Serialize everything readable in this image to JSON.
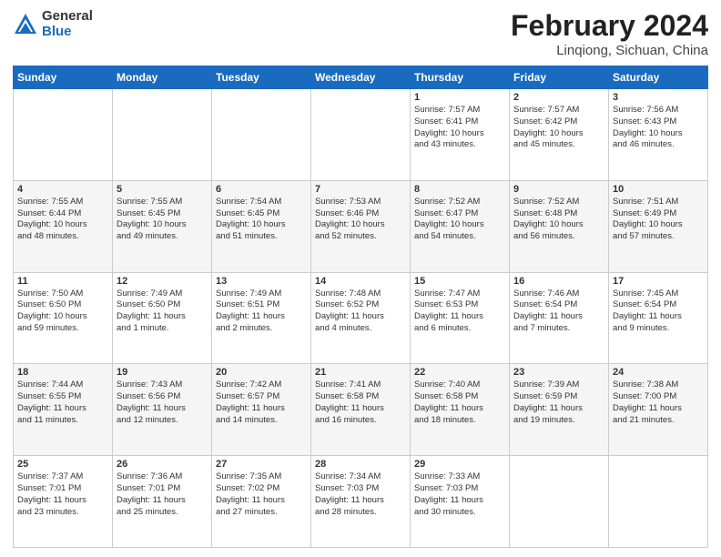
{
  "logo": {
    "general": "General",
    "blue": "Blue"
  },
  "title": {
    "month_year": "February 2024",
    "location": "Linqiong, Sichuan, China"
  },
  "weekdays": [
    "Sunday",
    "Monday",
    "Tuesday",
    "Wednesday",
    "Thursday",
    "Friday",
    "Saturday"
  ],
  "weeks": [
    [
      {
        "day": "",
        "info": ""
      },
      {
        "day": "",
        "info": ""
      },
      {
        "day": "",
        "info": ""
      },
      {
        "day": "",
        "info": ""
      },
      {
        "day": "1",
        "info": "Sunrise: 7:57 AM\nSunset: 6:41 PM\nDaylight: 10 hours\nand 43 minutes."
      },
      {
        "day": "2",
        "info": "Sunrise: 7:57 AM\nSunset: 6:42 PM\nDaylight: 10 hours\nand 45 minutes."
      },
      {
        "day": "3",
        "info": "Sunrise: 7:56 AM\nSunset: 6:43 PM\nDaylight: 10 hours\nand 46 minutes."
      }
    ],
    [
      {
        "day": "4",
        "info": "Sunrise: 7:55 AM\nSunset: 6:44 PM\nDaylight: 10 hours\nand 48 minutes."
      },
      {
        "day": "5",
        "info": "Sunrise: 7:55 AM\nSunset: 6:45 PM\nDaylight: 10 hours\nand 49 minutes."
      },
      {
        "day": "6",
        "info": "Sunrise: 7:54 AM\nSunset: 6:45 PM\nDaylight: 10 hours\nand 51 minutes."
      },
      {
        "day": "7",
        "info": "Sunrise: 7:53 AM\nSunset: 6:46 PM\nDaylight: 10 hours\nand 52 minutes."
      },
      {
        "day": "8",
        "info": "Sunrise: 7:52 AM\nSunset: 6:47 PM\nDaylight: 10 hours\nand 54 minutes."
      },
      {
        "day": "9",
        "info": "Sunrise: 7:52 AM\nSunset: 6:48 PM\nDaylight: 10 hours\nand 56 minutes."
      },
      {
        "day": "10",
        "info": "Sunrise: 7:51 AM\nSunset: 6:49 PM\nDaylight: 10 hours\nand 57 minutes."
      }
    ],
    [
      {
        "day": "11",
        "info": "Sunrise: 7:50 AM\nSunset: 6:50 PM\nDaylight: 10 hours\nand 59 minutes."
      },
      {
        "day": "12",
        "info": "Sunrise: 7:49 AM\nSunset: 6:50 PM\nDaylight: 11 hours\nand 1 minute."
      },
      {
        "day": "13",
        "info": "Sunrise: 7:49 AM\nSunset: 6:51 PM\nDaylight: 11 hours\nand 2 minutes."
      },
      {
        "day": "14",
        "info": "Sunrise: 7:48 AM\nSunset: 6:52 PM\nDaylight: 11 hours\nand 4 minutes."
      },
      {
        "day": "15",
        "info": "Sunrise: 7:47 AM\nSunset: 6:53 PM\nDaylight: 11 hours\nand 6 minutes."
      },
      {
        "day": "16",
        "info": "Sunrise: 7:46 AM\nSunset: 6:54 PM\nDaylight: 11 hours\nand 7 minutes."
      },
      {
        "day": "17",
        "info": "Sunrise: 7:45 AM\nSunset: 6:54 PM\nDaylight: 11 hours\nand 9 minutes."
      }
    ],
    [
      {
        "day": "18",
        "info": "Sunrise: 7:44 AM\nSunset: 6:55 PM\nDaylight: 11 hours\nand 11 minutes."
      },
      {
        "day": "19",
        "info": "Sunrise: 7:43 AM\nSunset: 6:56 PM\nDaylight: 11 hours\nand 12 minutes."
      },
      {
        "day": "20",
        "info": "Sunrise: 7:42 AM\nSunset: 6:57 PM\nDaylight: 11 hours\nand 14 minutes."
      },
      {
        "day": "21",
        "info": "Sunrise: 7:41 AM\nSunset: 6:58 PM\nDaylight: 11 hours\nand 16 minutes."
      },
      {
        "day": "22",
        "info": "Sunrise: 7:40 AM\nSunset: 6:58 PM\nDaylight: 11 hours\nand 18 minutes."
      },
      {
        "day": "23",
        "info": "Sunrise: 7:39 AM\nSunset: 6:59 PM\nDaylight: 11 hours\nand 19 minutes."
      },
      {
        "day": "24",
        "info": "Sunrise: 7:38 AM\nSunset: 7:00 PM\nDaylight: 11 hours\nand 21 minutes."
      }
    ],
    [
      {
        "day": "25",
        "info": "Sunrise: 7:37 AM\nSunset: 7:01 PM\nDaylight: 11 hours\nand 23 minutes."
      },
      {
        "day": "26",
        "info": "Sunrise: 7:36 AM\nSunset: 7:01 PM\nDaylight: 11 hours\nand 25 minutes."
      },
      {
        "day": "27",
        "info": "Sunrise: 7:35 AM\nSunset: 7:02 PM\nDaylight: 11 hours\nand 27 minutes."
      },
      {
        "day": "28",
        "info": "Sunrise: 7:34 AM\nSunset: 7:03 PM\nDaylight: 11 hours\nand 28 minutes."
      },
      {
        "day": "29",
        "info": "Sunrise: 7:33 AM\nSunset: 7:03 PM\nDaylight: 11 hours\nand 30 minutes."
      },
      {
        "day": "",
        "info": ""
      },
      {
        "day": "",
        "info": ""
      }
    ]
  ]
}
